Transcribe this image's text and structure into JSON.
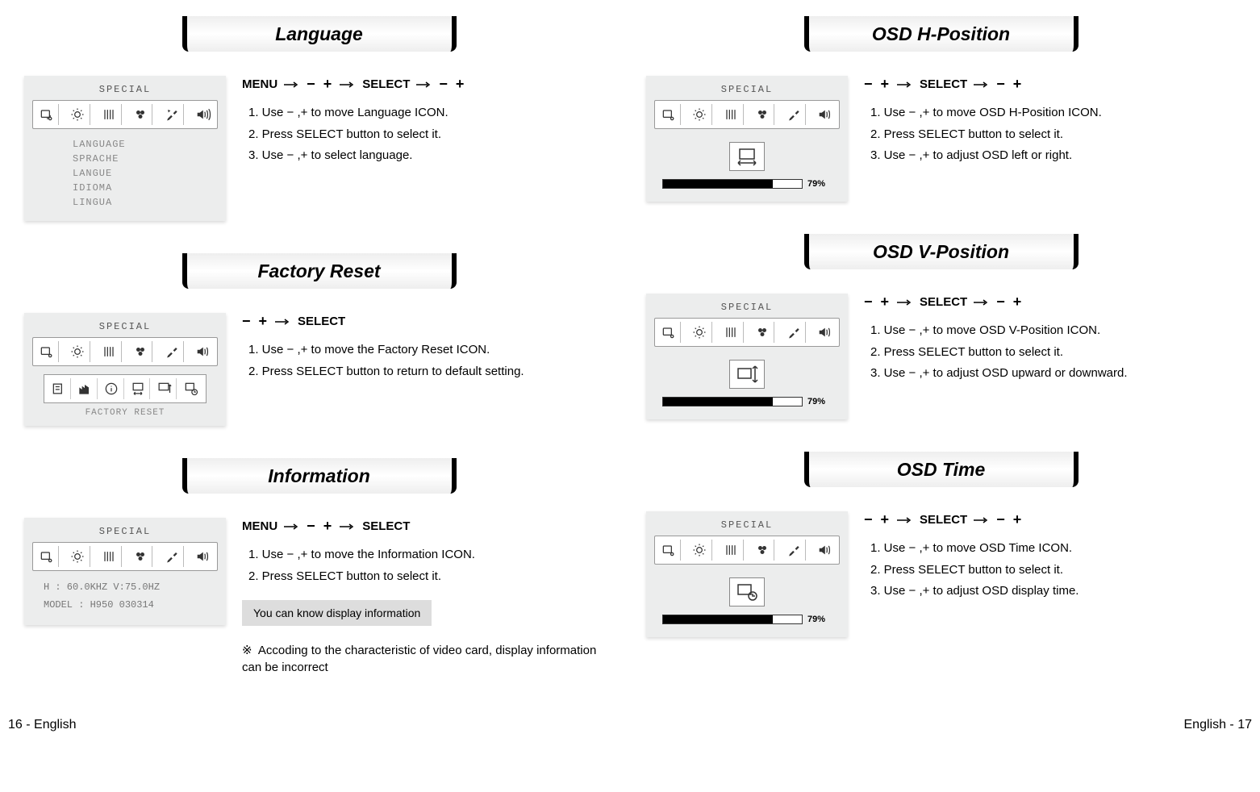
{
  "osd": {
    "title": "SPECIAL"
  },
  "buttons": {
    "menu": "MENU",
    "select": "SELECT"
  },
  "symbols": {
    "minus": "−",
    "plus": "+",
    "pm": "− ,+"
  },
  "language": {
    "heading": "Language",
    "list": [
      "LANGUAGE",
      "SPRACHE",
      "LANGUE",
      "IDIOMA",
      "LINGUA"
    ],
    "steps": [
      "1. Use − ,+ to move Language ICON.",
      "2. Press SELECT button to select it.",
      "3. Use − ,+ to select language."
    ]
  },
  "factory": {
    "heading": "Factory Reset",
    "sub_label": "FACTORY RESET",
    "steps": [
      "1. Use − ,+ to move the Factory Reset ICON.",
      "2. Press SELECT button to return to default setting."
    ]
  },
  "information": {
    "heading": "Information",
    "line1": "H : 60.0KHZ    V:75.0HZ",
    "line2": "MODEL : H950 030314",
    "steps": [
      "1. Use − ,+ to move the Information ICON.",
      "2. Press SELECT button to select it."
    ],
    "note": "You can know display information",
    "footnote": "Accoding to the characteristic of video card, display information can be incorrect",
    "footnote_symbol": "※"
  },
  "hpos": {
    "heading": "OSD H-Position",
    "pct": "79%",
    "fill": 79,
    "steps": [
      "1. Use − ,+ to move OSD H-Position ICON.",
      "2. Press SELECT button to select it.",
      "3. Use − ,+ to adjust OSD left or right."
    ]
  },
  "vpos": {
    "heading": "OSD V-Position",
    "pct": "79%",
    "fill": 79,
    "steps": [
      "1. Use − ,+ to move OSD V-Position ICON.",
      "2. Press SELECT button to select it.",
      "3. Use − ,+ to adjust OSD upward or downward."
    ]
  },
  "time": {
    "heading": "OSD Time",
    "pct": "79%",
    "fill": 79,
    "steps": [
      "1. Use − ,+ to move OSD Time ICON.",
      "2. Press SELECT button to select it.",
      "3. Use − ,+ to adjust OSD display time."
    ]
  },
  "footer": {
    "left": "16 - English",
    "right": "English - 17"
  }
}
